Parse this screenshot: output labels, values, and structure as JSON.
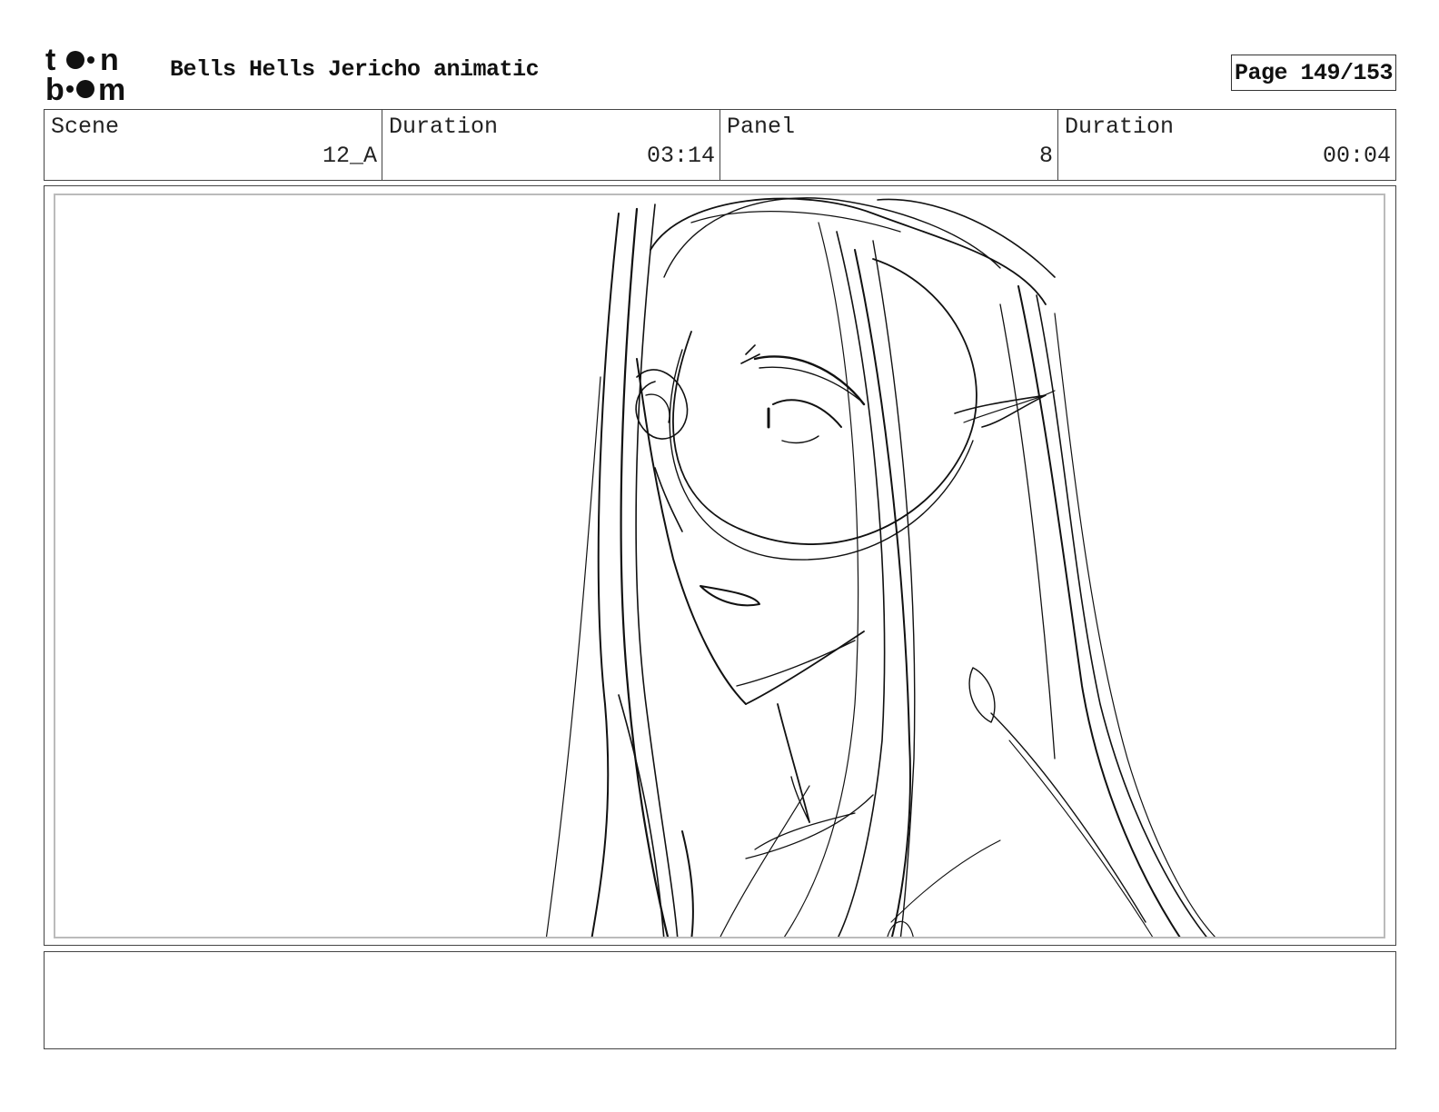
{
  "header": {
    "logo_top": "t",
    "logo_top_end": "n",
    "logo_bottom_start": "b",
    "logo_bottom_end": "m",
    "project_title": "Bells Hells Jericho animatic",
    "page": "Page 149/153"
  },
  "info": {
    "scene_label": "Scene",
    "scene_value": "12_A",
    "scene_duration_label": "Duration",
    "scene_duration_value": "03:14",
    "panel_label": "Panel",
    "panel_value": "8",
    "panel_duration_label": "Duration",
    "panel_duration_value": "00:04"
  },
  "notes": {
    "text": ""
  }
}
